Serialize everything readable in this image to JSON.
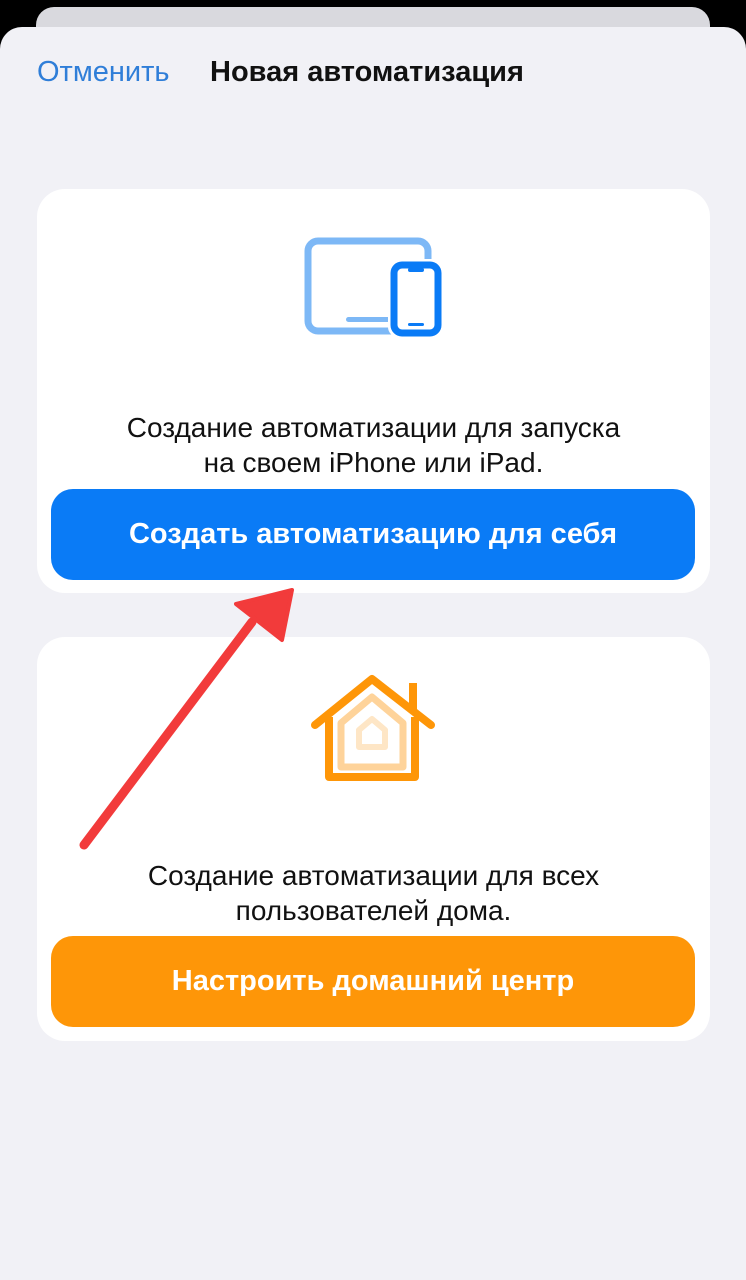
{
  "nav": {
    "cancel_label": "Отменить",
    "title": "Новая автоматизация"
  },
  "personal": {
    "icon": "ipad-iphone-icon",
    "description_line1": "Создание автоматизации для запуска",
    "description_line2": "на своем iPhone или iPad.",
    "button_label": "Создать автоматизацию для себя"
  },
  "home": {
    "icon": "home-icon",
    "description_line1": "Создание автоматизации для всех",
    "description_line2": "пользователей дома.",
    "button_label": "Настроить домашний центр"
  },
  "colors": {
    "accent_blue": "#0a7bf6",
    "accent_orange": "#fe9608",
    "link_blue": "#2f7ed8",
    "annotation_red": "#f23b3b",
    "background": "#f1f1f6"
  }
}
